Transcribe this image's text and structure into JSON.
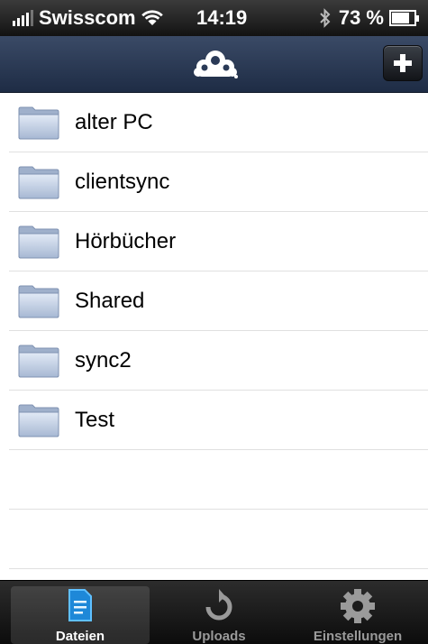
{
  "status_bar": {
    "carrier": "Swisscom",
    "time": "14:19",
    "battery": "73 %",
    "battery_level": 0.73
  },
  "nav_bar": {
    "logo_icon": "owncloud-logo-icon",
    "add_icon": "plus-icon"
  },
  "files": [
    {
      "name": "alter PC",
      "icon": "folder-icon"
    },
    {
      "name": "clientsync",
      "icon": "folder-icon"
    },
    {
      "name": "Hörbücher",
      "icon": "folder-icon"
    },
    {
      "name": "Shared",
      "icon": "folder-icon"
    },
    {
      "name": "sync2",
      "icon": "folder-icon"
    },
    {
      "name": "Test",
      "icon": "folder-icon"
    }
  ],
  "tabs": [
    {
      "label": "Dateien",
      "icon": "document-icon",
      "active": true
    },
    {
      "label": "Uploads",
      "icon": "refresh-icon",
      "active": false
    },
    {
      "label": "Einstellungen",
      "icon": "gear-icon",
      "active": false
    }
  ],
  "colors": {
    "nav_bar": "#2a3a57",
    "active_tab_icon": "#3aa0e8"
  }
}
